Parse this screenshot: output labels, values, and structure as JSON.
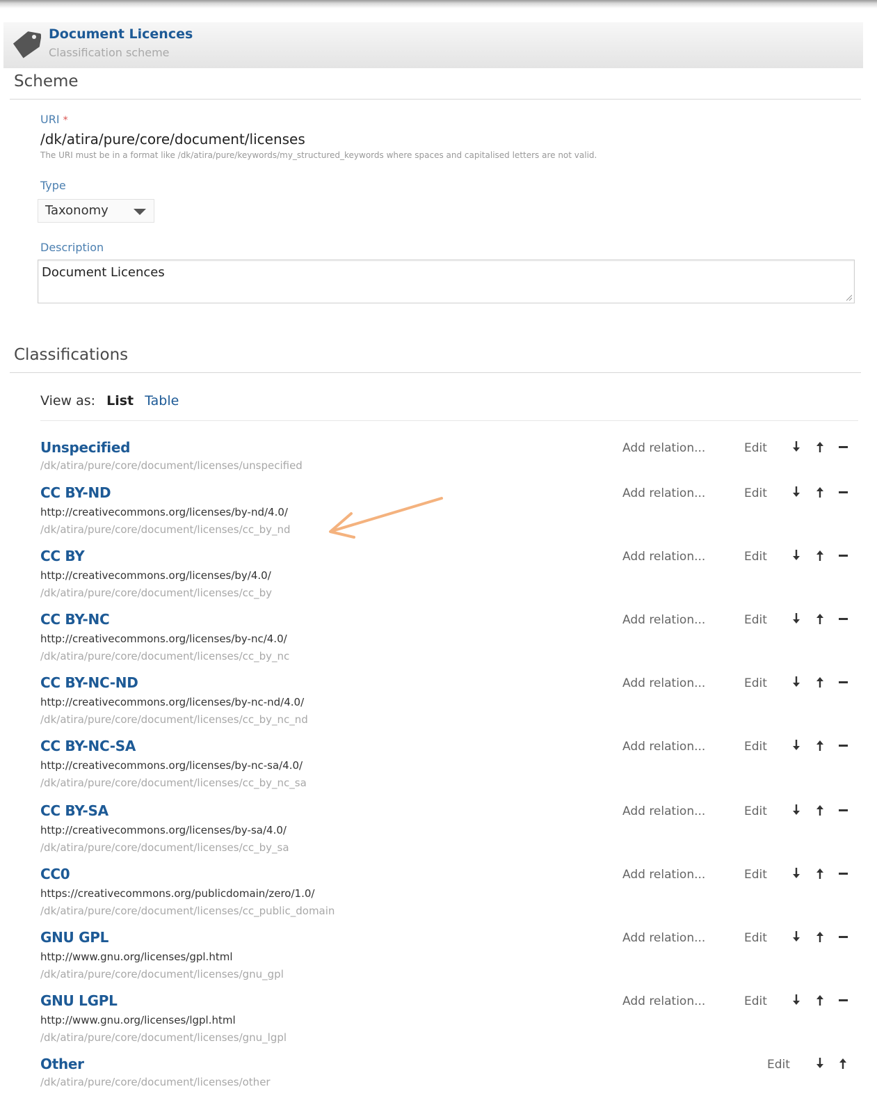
{
  "header": {
    "title": "Document Licences",
    "subtitle": "Classification scheme",
    "icon": "tag-icon"
  },
  "scheme": {
    "heading": "Scheme",
    "uri_label": "URI",
    "uri_required_mark": "*",
    "uri_value": "/dk/atira/pure/core/document/licenses",
    "uri_help": "The URI must be in a format like /dk/atira/pure/keywords/my_structured_keywords where spaces and capitalised letters are not valid.",
    "type_label": "Type",
    "type_value": "Taxonomy",
    "description_label": "Description",
    "description_value": "Document Licences"
  },
  "classifications": {
    "heading": "Classifications",
    "view_as_label": "View as:",
    "view_list": "List",
    "view_table": "Table",
    "add_relation_label": "Add relation...",
    "edit_label": "Edit",
    "items": [
      {
        "title": "Unspecified",
        "url": "",
        "path": "/dk/atira/pure/core/document/licenses/unspecified"
      },
      {
        "title": "CC BY-ND",
        "url": "http://creativecommons.org/licenses/by-nd/4.0/",
        "path": "/dk/atira/pure/core/document/licenses/cc_by_nd"
      },
      {
        "title": "CC BY",
        "url": "http://creativecommons.org/licenses/by/4.0/",
        "path": "/dk/atira/pure/core/document/licenses/cc_by"
      },
      {
        "title": "CC BY-NC",
        "url": "http://creativecommons.org/licenses/by-nc/4.0/",
        "path": "/dk/atira/pure/core/document/licenses/cc_by_nc"
      },
      {
        "title": "CC BY-NC-ND",
        "url": "http://creativecommons.org/licenses/by-nc-nd/4.0/",
        "path": "/dk/atira/pure/core/document/licenses/cc_by_nc_nd"
      },
      {
        "title": "CC BY-NC-SA",
        "url": "http://creativecommons.org/licenses/by-nc-sa/4.0/",
        "path": "/dk/atira/pure/core/document/licenses/cc_by_nc_sa"
      },
      {
        "title": "CC BY-SA",
        "url": "http://creativecommons.org/licenses/by-sa/4.0/",
        "path": "/dk/atira/pure/core/document/licenses/cc_by_sa"
      },
      {
        "title": "CC0",
        "url": "https://creativecommons.org/publicdomain/zero/1.0/",
        "path": "/dk/atira/pure/core/document/licenses/cc_public_domain"
      },
      {
        "title": "GNU GPL",
        "url": "http://www.gnu.org/licenses/gpl.html",
        "path": "/dk/atira/pure/core/document/licenses/gnu_gpl"
      },
      {
        "title": "GNU LGPL",
        "url": "http://www.gnu.org/licenses/lgpl.html",
        "path": "/dk/atira/pure/core/document/licenses/gnu_lgpl"
      },
      {
        "title": "Other",
        "url": "",
        "path": "/dk/atira/pure/core/document/licenses/other"
      }
    ]
  },
  "colors": {
    "link": "#1d5a96",
    "label": "#4b7fb0",
    "annotation_arrow": "#f4b27e"
  }
}
